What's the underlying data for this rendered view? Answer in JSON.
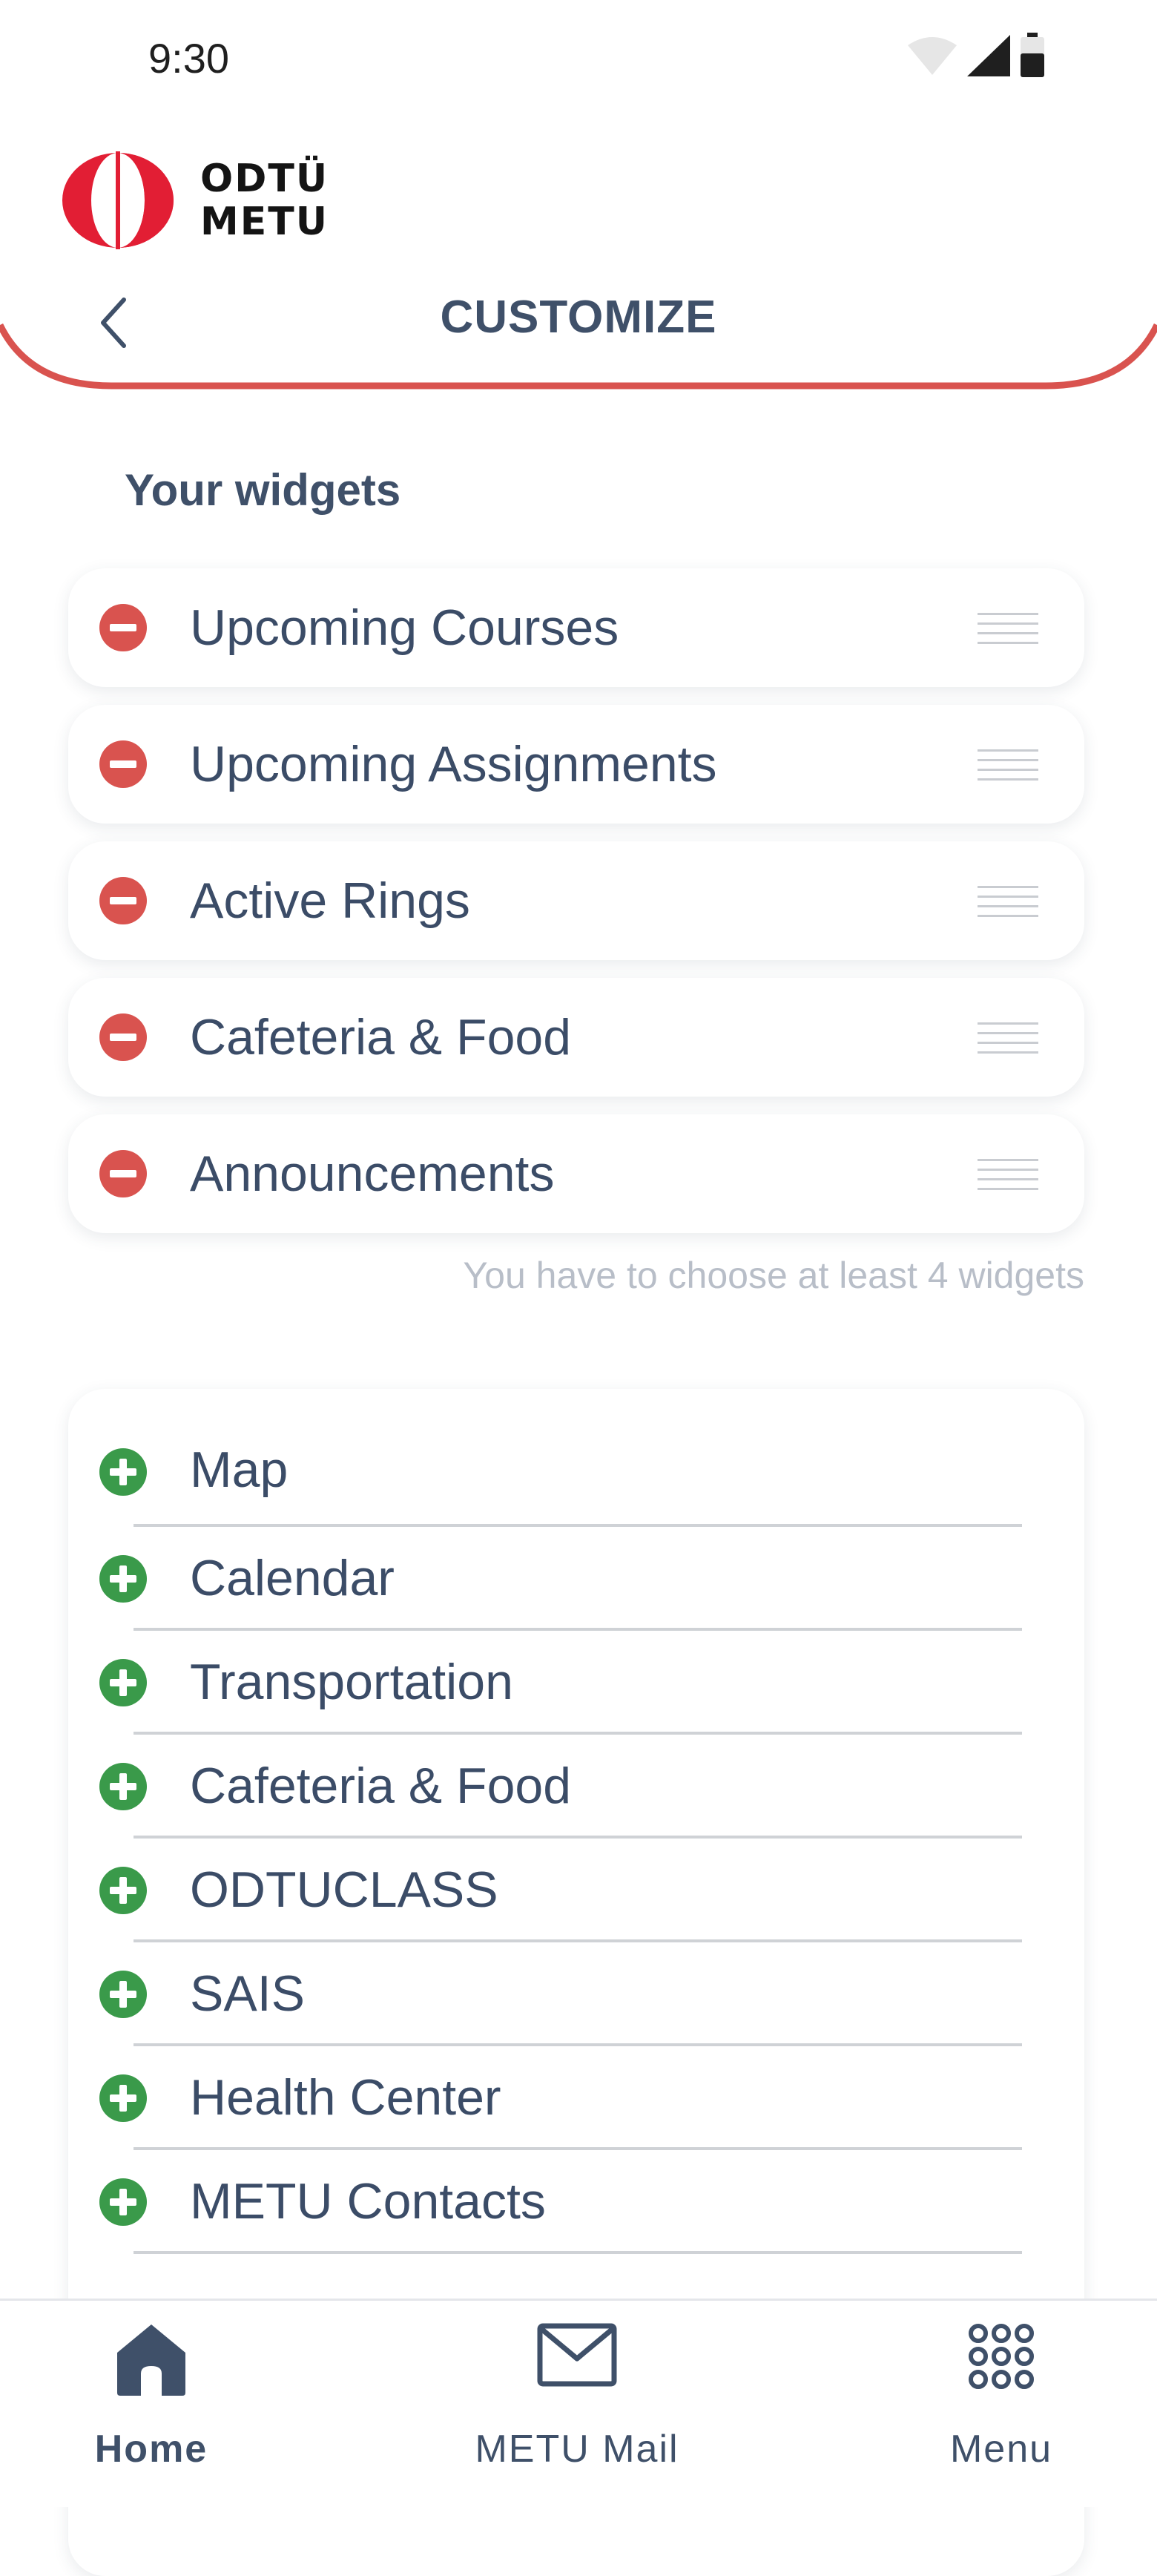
{
  "status_bar": {
    "time": "9:30"
  },
  "app": {
    "logo_line1": "ODTÜ",
    "logo_line2": "METU",
    "accent": "#d9534f",
    "primary": "#3f5069"
  },
  "header": {
    "title": "CUSTOMIZE",
    "back_icon": "chevron-left-icon"
  },
  "your_widgets": {
    "title": "Your widgets",
    "items": [
      {
        "label": "Upcoming Courses"
      },
      {
        "label": "Upcoming Assignments"
      },
      {
        "label": "Active Rings"
      },
      {
        "label": "Cafeteria & Food"
      },
      {
        "label": "Announcements"
      }
    ],
    "hint": "You have to choose at least 4 widgets"
  },
  "available_widgets": {
    "items": [
      {
        "label": "Map"
      },
      {
        "label": "Calendar"
      },
      {
        "label": "Transportation"
      },
      {
        "label": "Cafeteria & Food"
      },
      {
        "label": "ODTUCLASS"
      },
      {
        "label": "SAIS"
      },
      {
        "label": "Health Center"
      },
      {
        "label": "METU Contacts"
      }
    ]
  },
  "bottom_nav": {
    "items": [
      {
        "label": "Home",
        "icon": "home-icon",
        "active": true
      },
      {
        "label": "METU Mail",
        "icon": "mail-icon",
        "active": false
      },
      {
        "label": "Menu",
        "icon": "grid-menu-icon",
        "active": false
      }
    ]
  }
}
